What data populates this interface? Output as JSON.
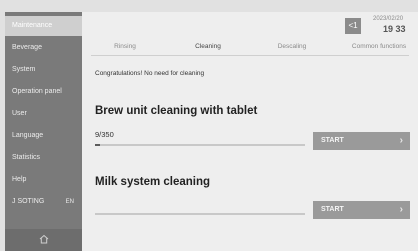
{
  "sidebar": {
    "items": [
      {
        "label": "Maintenance"
      },
      {
        "label": "Beverage"
      },
      {
        "label": "System"
      },
      {
        "label": "Operation panel"
      },
      {
        "label": "User"
      },
      {
        "label": "Language"
      },
      {
        "label": "Statistics"
      },
      {
        "label": "Help"
      },
      {
        "label": "J SOTING",
        "code": "EN"
      }
    ],
    "home_icon": "home-icon"
  },
  "header": {
    "back_label": "<1",
    "date": "2023/02/20",
    "time": "19 33"
  },
  "tabs": [
    {
      "label": "Rinsing"
    },
    {
      "label": "Cleaning"
    },
    {
      "label": "Descaling"
    },
    {
      "label": "Common functions"
    }
  ],
  "content": {
    "message": "Congratulations! No need for cleaning",
    "brew": {
      "title": "Brew unit cleaning with tablet",
      "count": "9/350",
      "progress": 0.026,
      "button": "START"
    },
    "milk": {
      "title": "Milk system cleaning",
      "progress": 0,
      "button": "START"
    }
  },
  "colors": {
    "sidebar_bg": "#7a7a7a",
    "active_item": "#cfcfcf",
    "button_bg": "#9a9a9a"
  }
}
